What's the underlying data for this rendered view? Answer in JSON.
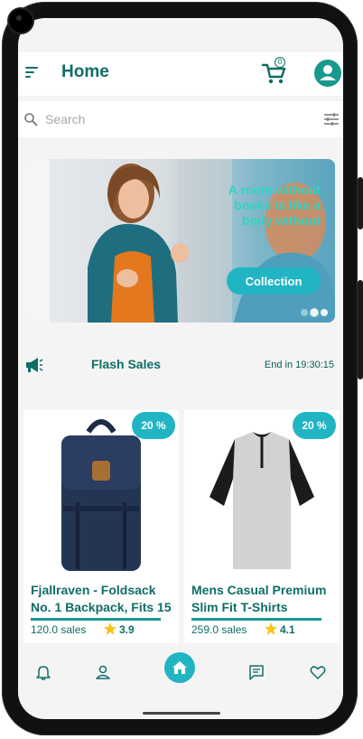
{
  "header": {
    "title": "Home",
    "cart_count": "0"
  },
  "search": {
    "placeholder": "Search"
  },
  "banner": {
    "text": "A room without books is like a body without",
    "button_label": "Collection",
    "slide_count": 3,
    "active_slide": 2
  },
  "flash_sales": {
    "title": "Flash Sales",
    "timer": "End in 19:30:15"
  },
  "products": [
    {
      "discount": "20 %",
      "name": "Fjallraven - Foldsack No. 1 Backpack, Fits 15",
      "sales": "120.0 sales",
      "rating": "3.9",
      "image": "backpack-image"
    },
    {
      "discount": "20 %",
      "name": "Mens Casual Premium Slim Fit T-Shirts",
      "sales": "259.0 sales",
      "rating": "4.1",
      "image": "tshirt-image"
    }
  ],
  "bottom_nav": {
    "items": [
      "bell-icon",
      "person-icon",
      "home-icon",
      "chat-icon",
      "heart-icon"
    ],
    "active": "home-icon"
  },
  "colors": {
    "primary": "#0e6e66",
    "accent": "#21b5c4",
    "banner_text": "#2fd4c2"
  }
}
